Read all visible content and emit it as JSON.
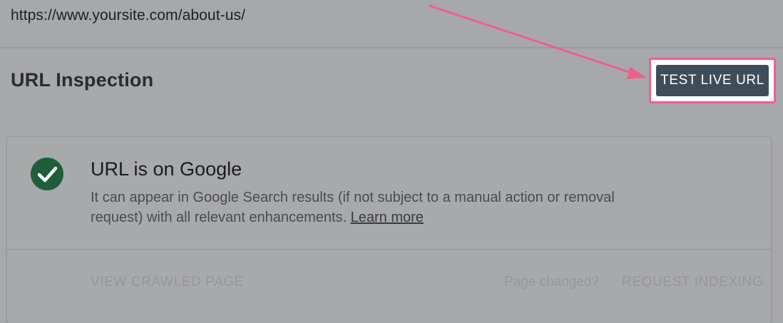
{
  "address_bar": {
    "url": "https://www.yoursite.com/about-us/"
  },
  "header": {
    "title": "URL Inspection",
    "test_live_label": "TEST LIVE URL"
  },
  "status_card": {
    "icon": "check-circle-icon",
    "title": "URL is on Google",
    "description": "It can appear in Google Search results (if not subject to a manual action or removal request) with all relevant enhancements.",
    "learn_more": "Learn more",
    "view_crawled_label": "VIEW CRAWLED PAGE",
    "page_changed_text": "Page changed?",
    "request_indexing_label": "REQUEST INDEXING"
  },
  "colors": {
    "overlay_bg": "#a7a8ab",
    "button_bg": "#3e4d57",
    "highlight": "#ee5f8c",
    "success": "#1f5e3a"
  }
}
